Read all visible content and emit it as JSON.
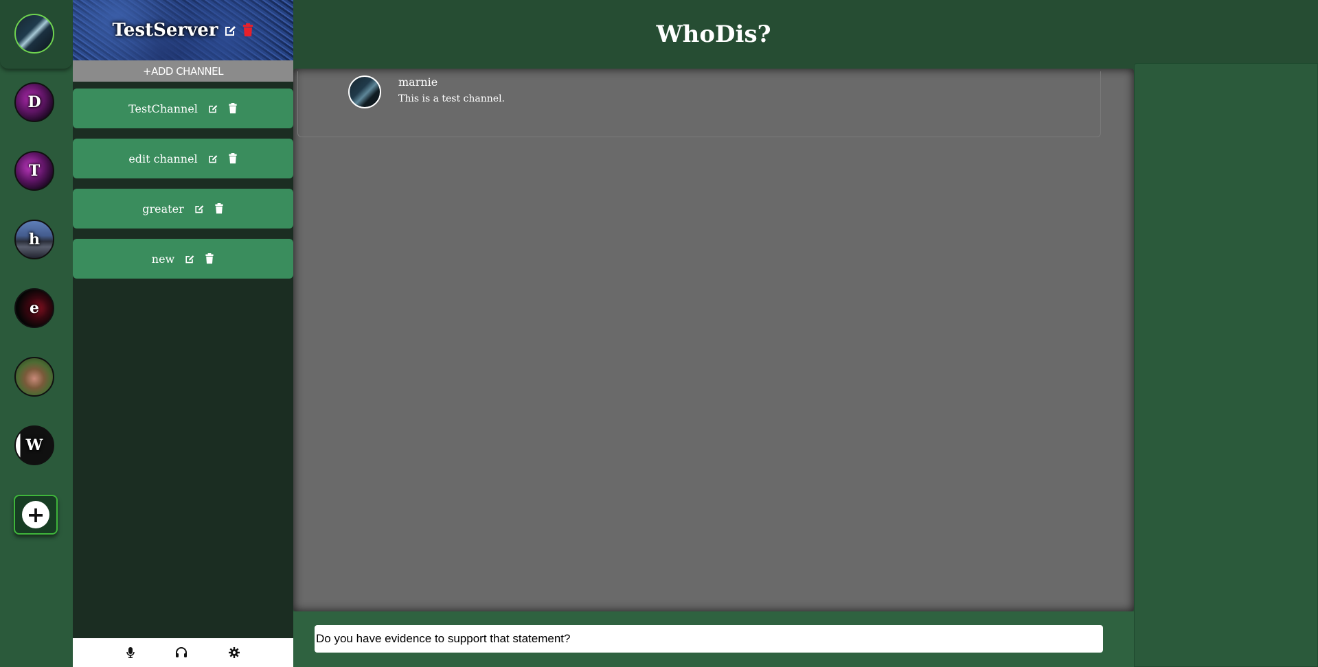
{
  "app": {
    "title": "WhoDis?"
  },
  "servers": [
    {
      "initial": "",
      "active": true
    },
    {
      "initial": "D"
    },
    {
      "initial": "T"
    },
    {
      "initial": "h"
    },
    {
      "initial": "e"
    },
    {
      "initial": ""
    },
    {
      "initial": "W"
    }
  ],
  "server": {
    "name": "TestServer",
    "add_channel_label": "+ADD CHANNEL"
  },
  "channels": [
    {
      "name": "TestChannel"
    },
    {
      "name": "edit channel"
    },
    {
      "name": "greater"
    },
    {
      "name": "new"
    }
  ],
  "messages": [
    {
      "username": "marnie",
      "text": "This is a test channel."
    }
  ],
  "composer": {
    "value": "Do you have evidence to support that statement?"
  },
  "colors": {
    "background": "#264d33",
    "channel_button": "#3a8d5d",
    "message_area": "#6a6a6a",
    "delete_server": "#e8202a"
  },
  "icons": {
    "edit": "edit-icon",
    "delete": "trash-icon",
    "mic": "microphone-icon",
    "headset": "headset-icon",
    "settings": "gear-icon",
    "add_server": "plus-icon"
  }
}
